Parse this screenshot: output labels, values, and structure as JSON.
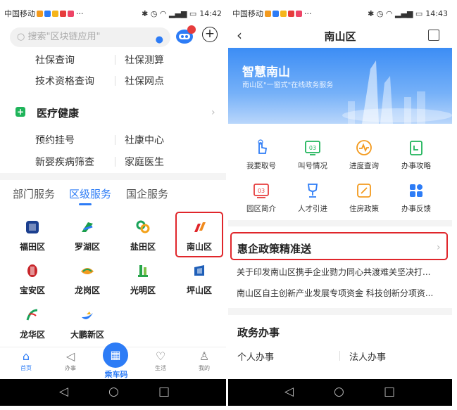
{
  "left": {
    "status": {
      "carrier": "中国移动",
      "time": "14:42",
      "icons": [
        "battery-icon",
        "wifi-icon",
        "signal-icon",
        "bluetooth-icon",
        "alarm-icon"
      ]
    },
    "search": {
      "placeholder": "搜索\"区块链应用\""
    },
    "social": {
      "rows": [
        [
          "社保查询",
          "社保测算"
        ],
        [
          "技术资格查询",
          "社保网点"
        ]
      ]
    },
    "medical": {
      "title": "医疗健康",
      "rows": [
        [
          "预约挂号",
          "社康中心"
        ],
        [
          "新婴疾病筛查",
          "家庭医生"
        ]
      ]
    },
    "tabs": [
      "部门服务",
      "区级服务",
      "国企服务"
    ],
    "active_tab": "区级服务",
    "districts": [
      "福田区",
      "罗湖区",
      "盐田区",
      "南山区",
      "宝安区",
      "龙岗区",
      "光明区",
      "坪山区",
      "龙华区",
      "大鹏新区"
    ],
    "bottom_tabs": {
      "home": "首页",
      "office": "办事",
      "ride": "乘车码",
      "life": "生活",
      "mine": "我的"
    },
    "ride_icon": "bus-code-icon"
  },
  "right": {
    "status": {
      "carrier": "中国移动",
      "time": "14:43"
    },
    "title": "南山区",
    "banner": {
      "title": "智慧南山",
      "subtitle": "南山区\"一窗式\"在线政务服务"
    },
    "services_row1": [
      "我要取号",
      "叫号情况",
      "进度查询",
      "办事攻略"
    ],
    "services_row2": [
      "园区简介",
      "人才引进",
      "住房政策",
      "办事反馈"
    ],
    "service_badge": "03",
    "policy_title": "惠企政策精准送",
    "news": [
      "关于印发南山区携手企业勠力同心共渡难关坚决打...",
      "南山区自主创新产业发展专项资金 科技创新分项资..."
    ],
    "gov_title": "政务办事",
    "gov_items": [
      "个人办事",
      "法人办事"
    ]
  },
  "colors": {
    "accent": "#2d7cf6",
    "highlight": "#e0262b",
    "medical": "#1fb45a"
  }
}
